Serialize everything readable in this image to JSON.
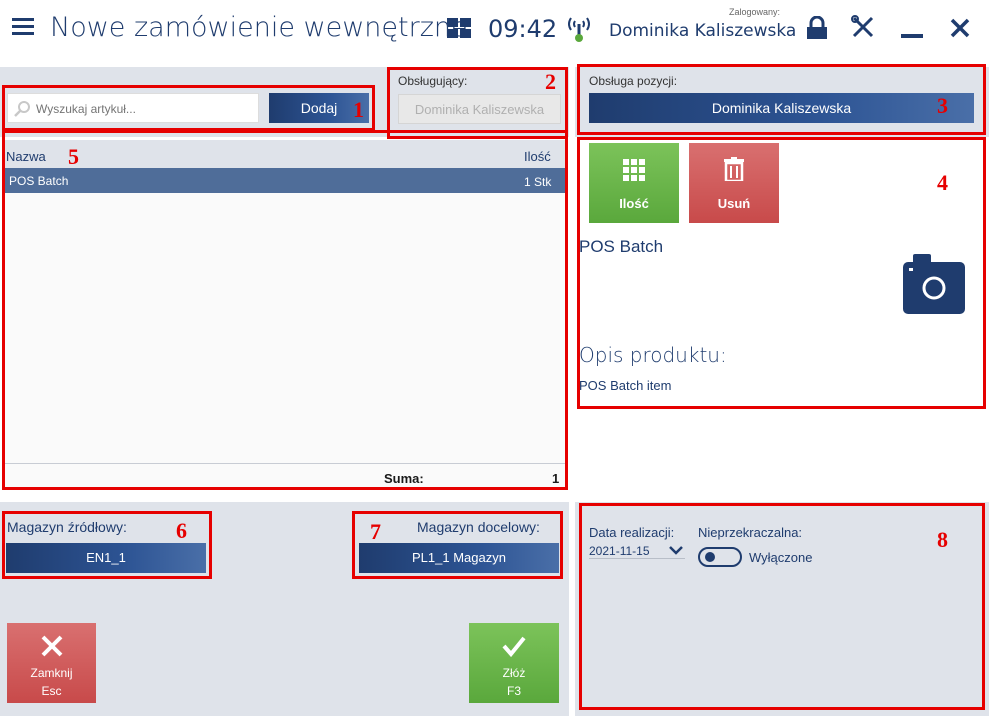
{
  "header": {
    "title": "Nowe zamówienie wewnętrzne",
    "time": "09:42",
    "logged_label": "Zalogowany:",
    "user": "Dominika Kaliszewska"
  },
  "search": {
    "placeholder": "Wyszukaj artykuł...",
    "add_label": "Dodaj"
  },
  "cashier": {
    "label": "Obsługujący:",
    "value": "Dominika Kaliszewska"
  },
  "item_handler": {
    "label": "Obsługa pozycji:",
    "value": "Dominika Kaliszewska"
  },
  "list": {
    "col_name": "Nazwa",
    "col_qty": "Ilość",
    "rows": [
      {
        "name": "POS Batch",
        "qty": "1 Stk"
      }
    ],
    "sum_label": "Suma:",
    "sum_value": "1"
  },
  "details": {
    "qty_tile": "Ilość",
    "delete_tile": "Usuń",
    "product_name": "POS Batch",
    "desc_heading": "Opis produktu:",
    "desc_text": "POS Batch item"
  },
  "warehouse": {
    "source_label": "Magazyn źródłowy:",
    "source_value": "EN1_1",
    "target_label": "Magazyn docelowy:",
    "target_value": "PL1_1 Magazyn"
  },
  "order": {
    "date_label": "Data realizacji:",
    "date_value": "2021-11-15",
    "binding_label": "Nieprzekraczalna:",
    "binding_value": "Wyłączone"
  },
  "footer": {
    "close_label": "Zamknij",
    "close_key": "Esc",
    "submit_label": "Złóż",
    "submit_key": "F3"
  },
  "annotations": [
    "1",
    "2",
    "3",
    "4",
    "5",
    "6",
    "7",
    "8"
  ],
  "colors": {
    "accent": "#1f3c6e",
    "green": "#6bb64a",
    "red": "#d05a5a",
    "annotation": "#e60000"
  }
}
